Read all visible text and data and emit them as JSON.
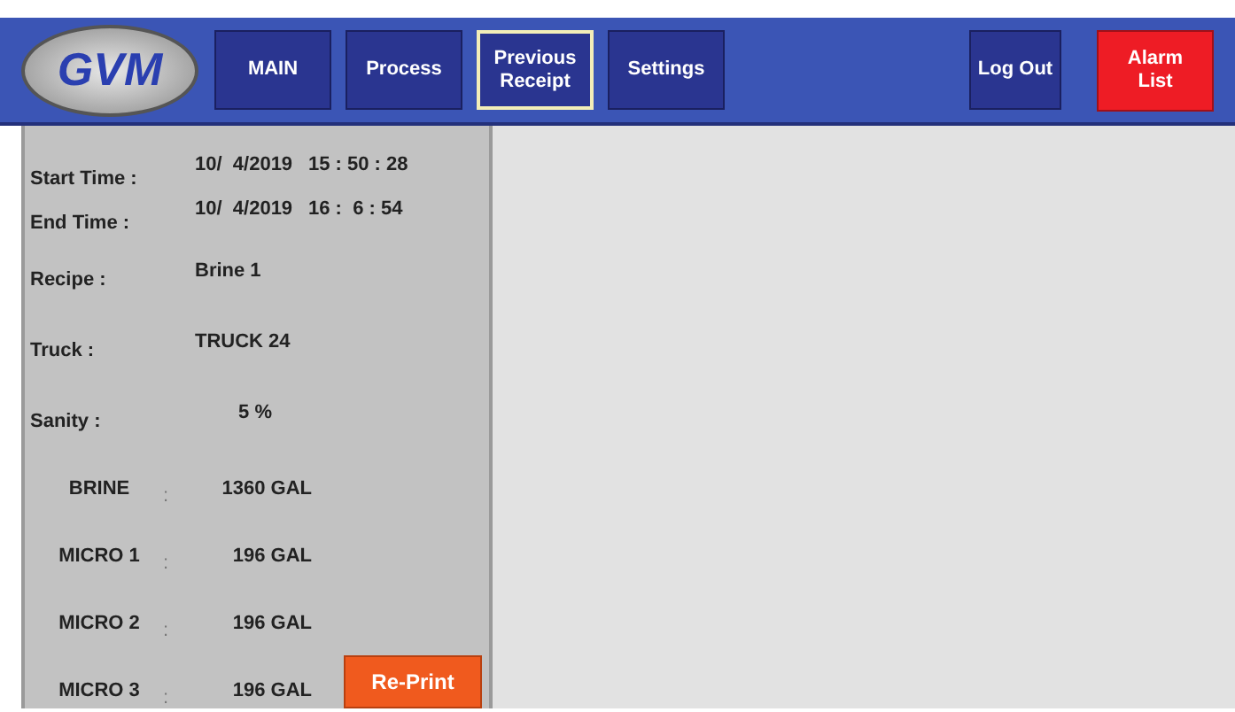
{
  "logo": {
    "text": "GVM"
  },
  "nav_buttons": [
    {
      "label": "MAIN",
      "selected": false
    },
    {
      "label": "Process",
      "selected": false
    },
    {
      "label": "Previous Receipt",
      "selected": true
    },
    {
      "label": "Settings",
      "selected": false
    }
  ],
  "right_buttons": [
    {
      "label": "Log Out",
      "kind": "normal"
    },
    {
      "label": "Alarm List",
      "kind": "alarm"
    }
  ],
  "receipt": {
    "times": [
      {
        "label": "Start Time :",
        "date": "10/  4/2019",
        "time": "15 : 50 : 28"
      },
      {
        "label": "End Time :",
        "date": "10/  4/2019",
        "time": "16 :  6 : 54"
      }
    ],
    "fields": [
      {
        "label": "Recipe :",
        "value": "Brine 1"
      },
      {
        "label": "Truck :",
        "value": "TRUCK 24"
      },
      {
        "label": "Sanity :",
        "value": "5 %"
      }
    ],
    "products": [
      {
        "name": "BRINE",
        "separator": ":",
        "amount": "1360 GAL"
      },
      {
        "name": "MICRO 1",
        "separator": ":",
        "amount": "196 GAL"
      },
      {
        "name": "MICRO 2",
        "separator": ":",
        "amount": "196 GAL"
      },
      {
        "name": "MICRO 3",
        "separator": ":",
        "amount": "196 GAL"
      }
    ],
    "reprint_button": "Re-Print"
  }
}
